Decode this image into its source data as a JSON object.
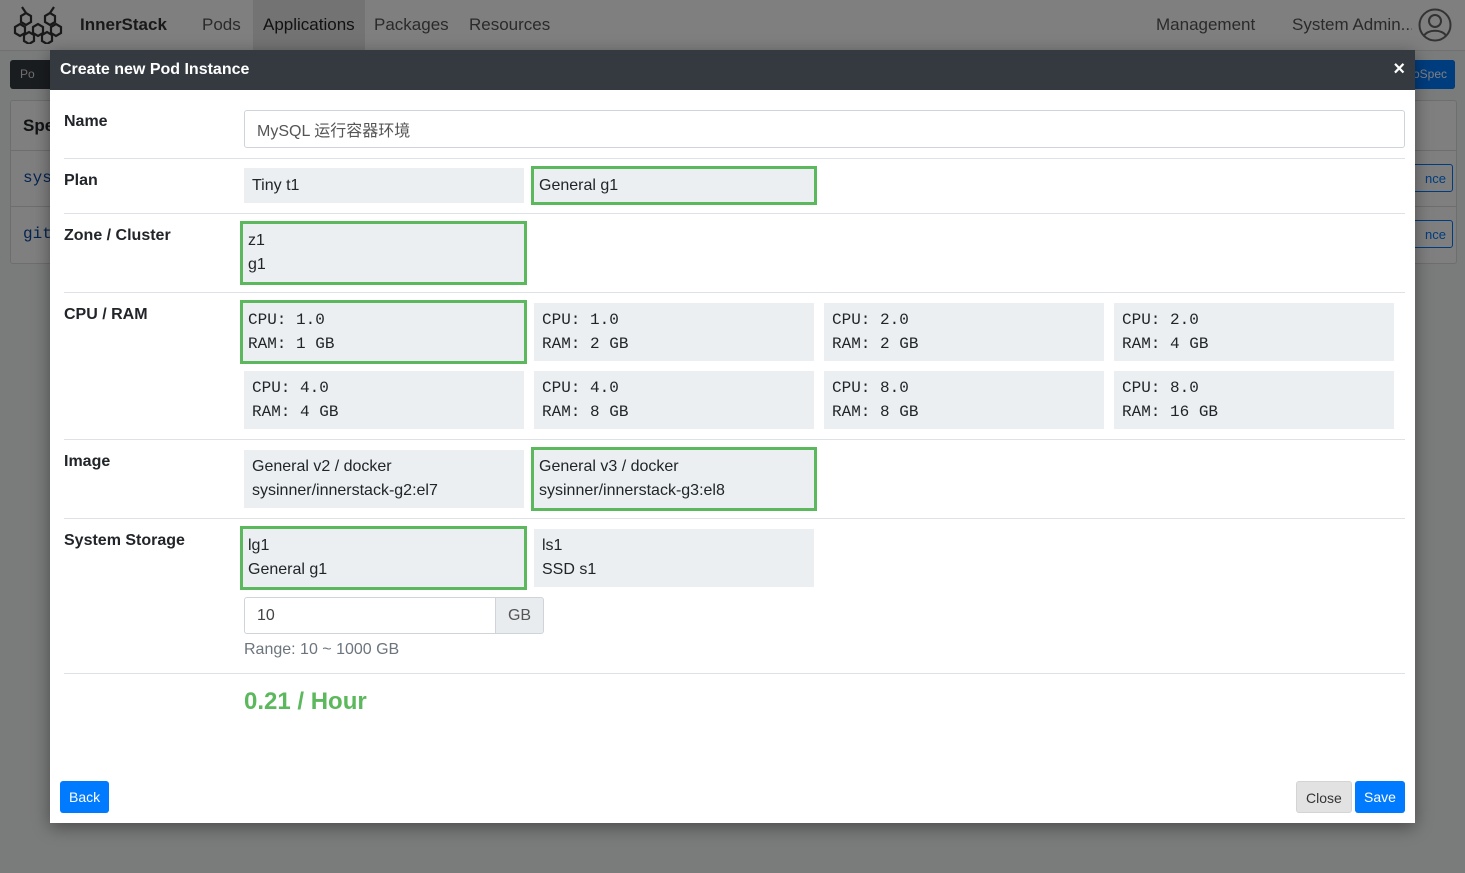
{
  "navbar": {
    "brand": "InnerStack",
    "items": [
      {
        "label": "Pods",
        "active": false
      },
      {
        "label": "Applications",
        "active": true
      },
      {
        "label": "Packages",
        "active": false
      },
      {
        "label": "Resources",
        "active": false
      }
    ],
    "management": "Management",
    "user": "System Admin..."
  },
  "background": {
    "toolbar_left": "Po",
    "toolbar_right": "oSpec",
    "table_header": "Spe",
    "rows": [
      "sys",
      "git"
    ],
    "row_button": "nce"
  },
  "modal": {
    "title": "Create new Pod Instance",
    "close_icon": "×",
    "name": {
      "label": "Name",
      "value": "MySQL 运行容器环境"
    },
    "plan": {
      "label": "Plan",
      "options": [
        {
          "text": "Tiny t1",
          "selected": false
        },
        {
          "text": "General g1",
          "selected": true
        }
      ]
    },
    "zone": {
      "label": "Zone / Cluster",
      "options": [
        {
          "line1": "z1",
          "line2": "g1",
          "selected": true
        }
      ]
    },
    "cpu_ram": {
      "label": "CPU / RAM",
      "options": [
        {
          "cpu": "CPU: 1.0",
          "ram": "RAM: 1 GB",
          "selected": true
        },
        {
          "cpu": "CPU: 1.0",
          "ram": "RAM: 2 GB",
          "selected": false
        },
        {
          "cpu": "CPU: 2.0",
          "ram": "RAM: 2 GB",
          "selected": false
        },
        {
          "cpu": "CPU: 2.0",
          "ram": "RAM: 4 GB",
          "selected": false
        },
        {
          "cpu": "CPU: 4.0",
          "ram": "RAM: 4 GB",
          "selected": false
        },
        {
          "cpu": "CPU: 4.0",
          "ram": "RAM: 8 GB",
          "selected": false
        },
        {
          "cpu": "CPU: 8.0",
          "ram": "RAM: 8 GB",
          "selected": false
        },
        {
          "cpu": "CPU: 8.0",
          "ram": "RAM: 16 GB",
          "selected": false
        }
      ]
    },
    "image": {
      "label": "Image",
      "options": [
        {
          "line1": "General v2 / docker",
          "line2": "sysinner/innerstack-g2:el7",
          "selected": false
        },
        {
          "line1": "General v3 / docker",
          "line2": "sysinner/innerstack-g3:el8",
          "selected": true
        }
      ]
    },
    "storage": {
      "label": "System Storage",
      "options": [
        {
          "line1": "lg1",
          "line2": "General g1",
          "selected": true
        },
        {
          "line1": "ls1",
          "line2": "SSD s1",
          "selected": false
        }
      ],
      "size_value": "10",
      "unit": "GB",
      "range": "Range: 10 ~ 1000 GB"
    },
    "price": "0.21 / Hour",
    "buttons": {
      "back": "Back",
      "close": "Close",
      "save": "Save"
    }
  },
  "colors": {
    "accent": "#007bff",
    "selected_border": "#5cb85c",
    "header_bg": "#343a40",
    "option_bg": "#eceff1"
  }
}
